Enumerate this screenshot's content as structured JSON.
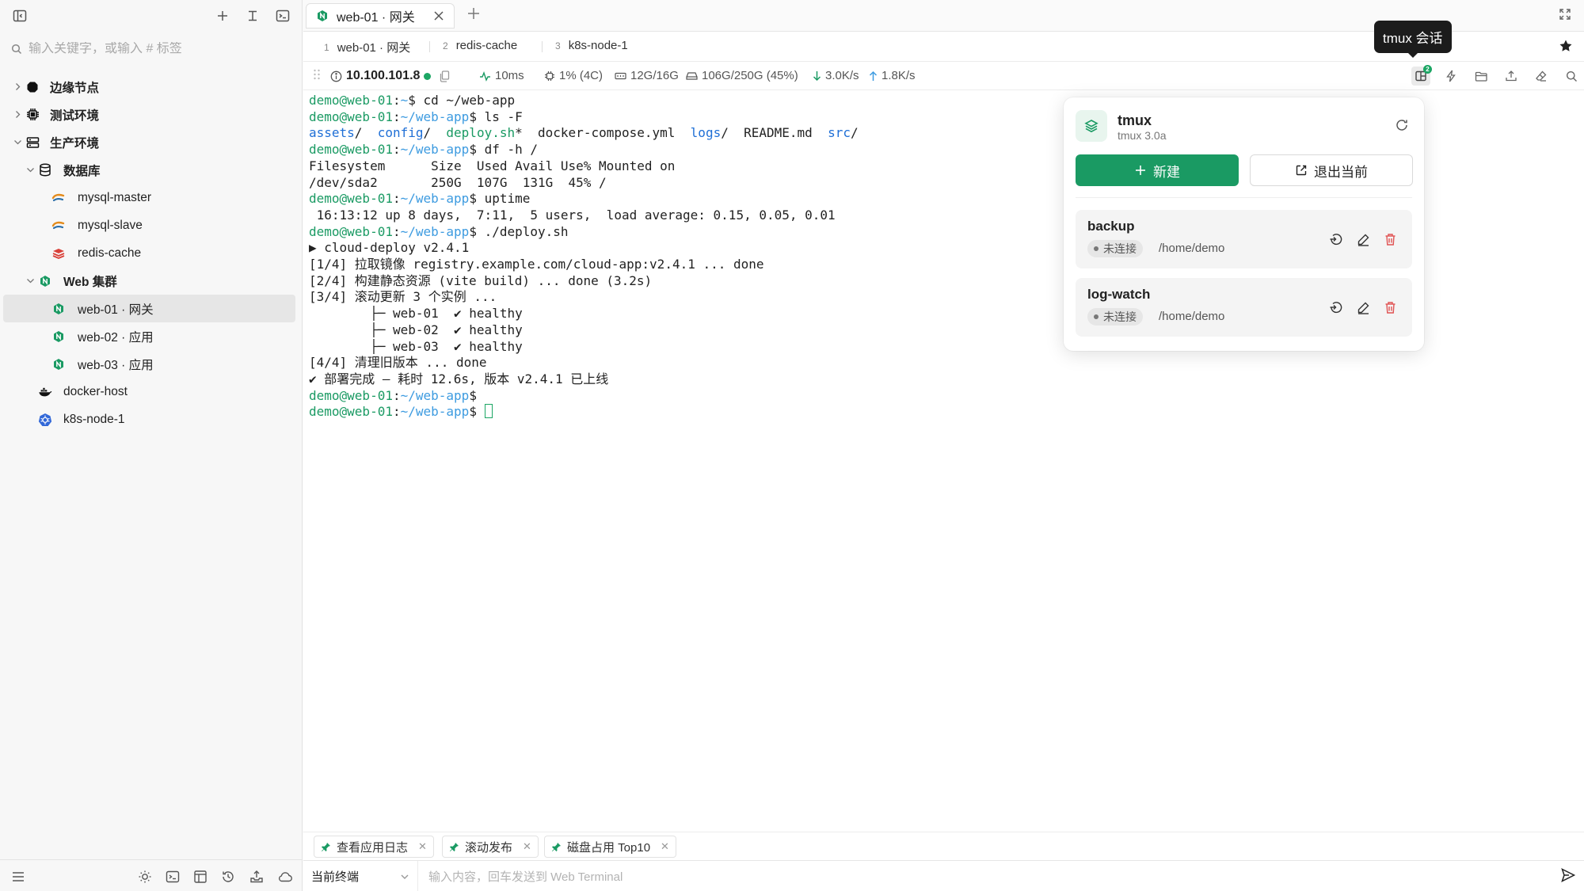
{
  "sidebar": {
    "search_placeholder": "输入关键字，或输入 # 标签",
    "tree": [
      {
        "label": "边缘节点",
        "bold": true,
        "depth": 0,
        "chevron": "right",
        "icon": "octagon-icon"
      },
      {
        "label": "测试环境",
        "bold": true,
        "depth": 0,
        "chevron": "right",
        "icon": "chip-icon"
      },
      {
        "label": "生产环境",
        "bold": true,
        "depth": 0,
        "chevron": "down",
        "icon": "server-icon"
      },
      {
        "label": "数据库",
        "bold": true,
        "depth": 1,
        "chevron": "down",
        "icon": "database-icon"
      },
      {
        "label": "mysql-master",
        "bold": false,
        "depth": 2,
        "icon": "mysql-icon"
      },
      {
        "label": "mysql-slave",
        "bold": false,
        "depth": 2,
        "icon": "mysql-icon"
      },
      {
        "label": "redis-cache",
        "bold": false,
        "depth": 2,
        "icon": "redis-icon"
      },
      {
        "label": "Web 集群",
        "bold": true,
        "depth": 1,
        "chevron": "down",
        "icon": "nginx-icon"
      },
      {
        "label": "web-01 · 网关",
        "bold": false,
        "depth": 2,
        "icon": "nginx-icon",
        "selected": true
      },
      {
        "label": "web-02 · 应用",
        "bold": false,
        "depth": 2,
        "icon": "nginx-icon"
      },
      {
        "label": "web-03 · 应用",
        "bold": false,
        "depth": 2,
        "icon": "nginx-icon"
      },
      {
        "label": "docker-host",
        "bold": false,
        "depth": 1,
        "icon": "docker-icon"
      },
      {
        "label": "k8s-node-1",
        "bold": false,
        "depth": 1,
        "icon": "kubernetes-icon"
      }
    ]
  },
  "tabbar": {
    "active_tab": "web-01 · 网关"
  },
  "subtabs": [
    {
      "num": "1",
      "label": "web-01 · 网关"
    },
    {
      "num": "2",
      "label": "redis-cache"
    },
    {
      "num": "3",
      "label": "k8s-node-1"
    }
  ],
  "status": {
    "ip": "10.100.101.8",
    "latency": "10ms",
    "cpu": "1% (4C)",
    "mem": "12G/16G",
    "disk": "106G/250G (45%)",
    "down": "3.0K/s",
    "up": "1.8K/s",
    "tmux_badge": "2"
  },
  "terminal": {
    "prompt_user": "demo@web-01",
    "lines": [
      {
        "type": "cmd",
        "path": "~",
        "cmd": "cd ~/web-app"
      },
      {
        "type": "cmd",
        "path": "~/web-app",
        "cmd": "ls -F"
      },
      {
        "type": "ls"
      },
      {
        "type": "cmd",
        "path": "~/web-app",
        "cmd": "df -h /"
      },
      {
        "type": "out",
        "text": "Filesystem      Size  Used Avail Use% Mounted on"
      },
      {
        "type": "out",
        "text": "/dev/sda2       250G  107G  131G  45% /"
      },
      {
        "type": "cmd",
        "path": "~/web-app",
        "cmd": "uptime"
      },
      {
        "type": "out",
        "text": " 16:13:12 up 8 days,  7:11,  5 users,  load average: 0.15, 0.05, 0.01"
      },
      {
        "type": "cmd",
        "path": "~/web-app",
        "cmd": "./deploy.sh"
      },
      {
        "type": "out",
        "text": "▶ cloud-deploy v2.4.1"
      },
      {
        "type": "out",
        "text": "[1/4] 拉取镜像 registry.example.com/cloud-app:v2.4.1 ... done"
      },
      {
        "type": "out",
        "text": "[2/4] 构建静态资源 (vite build) ... done (3.2s)"
      },
      {
        "type": "out",
        "text": "[3/4] 滚动更新 3 个实例 ..."
      },
      {
        "type": "out",
        "text": "        ├─ web-01  ✔ healthy"
      },
      {
        "type": "out",
        "text": "        ├─ web-02  ✔ healthy"
      },
      {
        "type": "out",
        "text": "        ├─ web-03  ✔ healthy"
      },
      {
        "type": "out",
        "text": "[4/4] 清理旧版本 ... done"
      },
      {
        "type": "out",
        "text": "✔ 部署完成 — 耗时 12.6s, 版本 v2.4.1 已上线"
      },
      {
        "type": "cmd",
        "path": "~/web-app",
        "cmd": ""
      },
      {
        "type": "cmd",
        "path": "~/web-app",
        "cmd": "",
        "cursor": true
      }
    ],
    "ls_items": [
      {
        "text": "assets",
        "suffix": "/",
        "kind": "dir"
      },
      {
        "text": "config",
        "suffix": "/",
        "kind": "dir"
      },
      {
        "text": "deploy.sh",
        "suffix": "*",
        "kind": "exe"
      },
      {
        "text": "docker-compose.yml",
        "suffix": "",
        "kind": "file"
      },
      {
        "text": "logs",
        "suffix": "/",
        "kind": "dir"
      },
      {
        "text": "README.md",
        "suffix": "",
        "kind": "file"
      },
      {
        "text": "src",
        "suffix": "/",
        "kind": "dir"
      }
    ]
  },
  "tooltip": "tmux 会话",
  "tmux": {
    "title": "tmux",
    "version": "tmux 3.0a",
    "new_label": "新建",
    "quit_label": "退出当前",
    "sessions": [
      {
        "name": "backup",
        "status": "未连接",
        "path": "/home/demo"
      },
      {
        "name": "log-watch",
        "status": "未连接",
        "path": "/home/demo"
      }
    ]
  },
  "snippets": [
    {
      "label": "查看应用日志"
    },
    {
      "label": "滚动发布"
    },
    {
      "label": "磁盘占用 Top10"
    }
  ],
  "inputbar": {
    "target": "当前终端",
    "placeholder": "输入内容，回车发送到 Web Terminal"
  },
  "colors": {
    "accent": "#1a9a63",
    "path": "#3d9be0",
    "danger": "#e05252"
  }
}
